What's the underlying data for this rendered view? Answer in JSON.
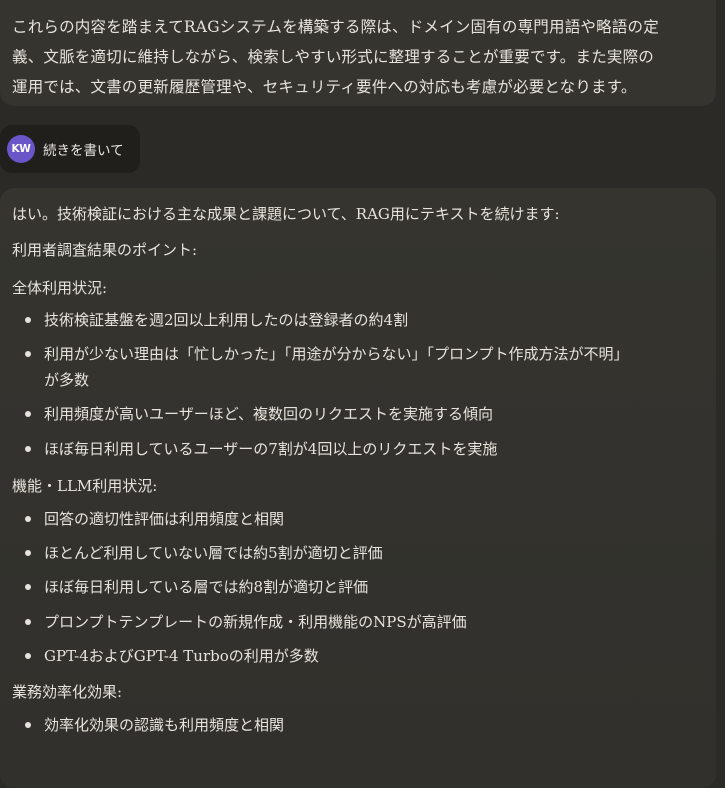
{
  "previous_message": {
    "lines": [
      "これらの内容を踏まえてRAGシステムを構築する際は、ドメイン固有の専門用語や略語の定",
      "義、文脈を適切に維持しながら、検索しやすい形式に整理することが重要です。また実際の",
      "運用では、文書の更新履歴管理や、セキュリティ要件への対応も考慮が必要となります。"
    ]
  },
  "user_message": {
    "avatar_initials": "KW",
    "text": "続きを書いて"
  },
  "response": {
    "intro": "はい。技術検証における主な成果と課題について、RAG用にテキストを続けます:",
    "section_title": "利用者調査結果のポイント:",
    "sections": [
      {
        "heading": "全体利用状況:",
        "items": [
          "技術検証基盤を週2回以上利用したのは登録者の約4割",
          "利用が少ない理由は「忙しかった」「用途が分からない」「プロンプト作成方法が不明」",
          "利用頻度が高いユーザーほど、複数回のリクエストを実施する傾向",
          "ほぼ毎日利用しているユーザーの7割が4回以上のリクエストを実施"
        ],
        "item2_continuation": "が多数"
      },
      {
        "heading": "機能・LLM利用状況:",
        "items": [
          "回答の適切性評価は利用頻度と相関",
          "ほとんど利用していない層では約5割が適切と評価",
          "ほぼ毎日利用している層では約8割が適切と評価",
          "プロンプトテンプレートの新規作成・利用機能のNPSが高評価",
          "GPT-4およびGPT-4 Turboの利用が多数"
        ]
      },
      {
        "heading": "業務効率化効果:",
        "items": [
          "効率化効果の認識も利用頻度と相関"
        ]
      }
    ]
  }
}
